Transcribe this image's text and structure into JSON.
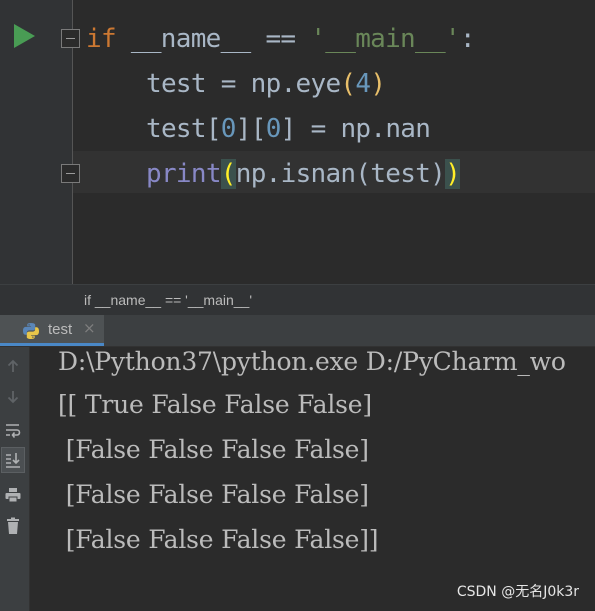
{
  "editor": {
    "lines": [
      {
        "tokens": [
          {
            "text": "if",
            "cls": "kw"
          },
          {
            "text": " __name__ == ",
            "cls": "id"
          },
          {
            "text": "'__main__'",
            "cls": "str"
          },
          {
            "text": ":",
            "cls": "id"
          }
        ]
      },
      {
        "tokens": [
          {
            "text": "test = np.eye",
            "cls": "id"
          },
          {
            "text": "(",
            "cls": "br-y"
          },
          {
            "text": "4",
            "cls": "num"
          },
          {
            "text": ")",
            "cls": "br-y"
          }
        ]
      },
      {
        "tokens": [
          {
            "text": "test",
            "cls": "id"
          },
          {
            "text": "[",
            "cls": "br"
          },
          {
            "text": "0",
            "cls": "num"
          },
          {
            "text": "][",
            "cls": "br"
          },
          {
            "text": "0",
            "cls": "num"
          },
          {
            "text": "] = np.nan",
            "cls": "id"
          }
        ]
      },
      {
        "tokens": [
          {
            "text": "print",
            "cls": "bi"
          },
          {
            "text": "(",
            "cls": "br-hl"
          },
          {
            "text": "np.isnan(test)",
            "cls": "id"
          },
          {
            "text": ")",
            "cls": "br-hl"
          }
        ]
      }
    ]
  },
  "breadcrumb": {
    "text": "if __name__ == '__main__'"
  },
  "run_panel": {
    "tab_label": "test",
    "tab_close": "×",
    "output": [
      "D:\\Python37\\python.exe D:/PyCharm_wo",
      "[[ True False False False]",
      " [False False False False]",
      " [False False False False]",
      " [False False False False]]"
    ]
  },
  "watermark": "CSDN @无名J0k3r",
  "colors": {
    "keyword": "#cc7832",
    "identifier": "#a9b7c6",
    "string": "#6a8759",
    "number": "#6897bb",
    "builtin": "#8888c6",
    "run_green": "#499c54"
  },
  "icons": {
    "run": "run-icon",
    "toolbar": [
      "arrow-up-icon",
      "arrow-down-icon",
      "soft-wrap-icon",
      "scroll-to-end-icon",
      "print-icon",
      "trash-icon"
    ]
  }
}
